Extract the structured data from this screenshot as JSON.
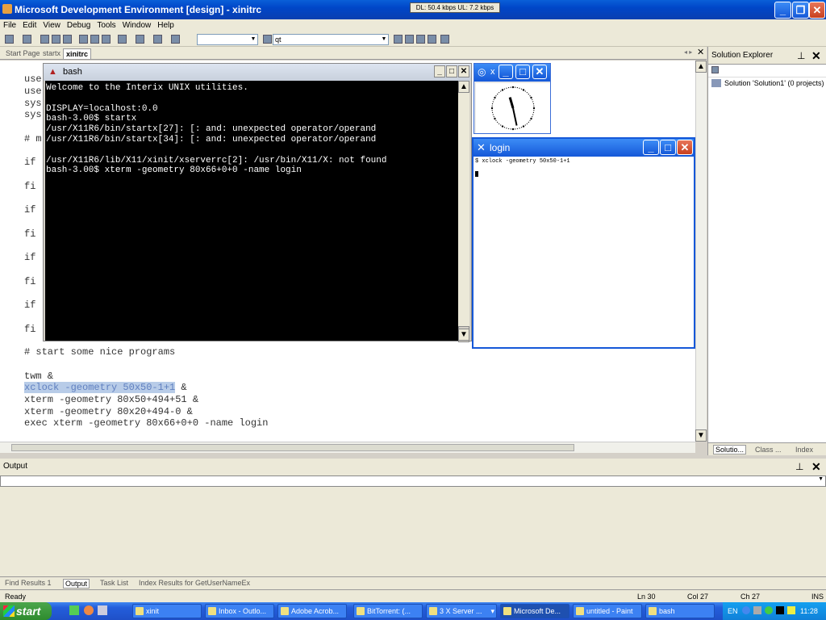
{
  "window": {
    "title": "Microsoft Development Environment [design] - xinitrc",
    "netmeter": "DL: 50.4 kbps  UL: 7.2 kbps"
  },
  "menu": [
    "File",
    "Edit",
    "View",
    "Debug",
    "Tools",
    "Window",
    "Help"
  ],
  "toolbar": {
    "combo1": "",
    "combo2": "qt"
  },
  "tabs": [
    "Start Page",
    "startx",
    "xinitrc"
  ],
  "editor": {
    "lines": [
      "use",
      "use",
      "sys",
      "sys",
      "# m",
      "if",
      "fi",
      "if",
      "fi",
      "if",
      "fi",
      "if",
      "fi",
      "# start some nice programs",
      "",
      "twm &",
      "xclock -geometry 50x50-1+1 &",
      "xterm -geometry 80x50+494+51 &",
      "xterm -geometry 80x20+494-0 &",
      "exec xterm -geometry 80x66+0+0 -name login"
    ],
    "selected": "xclock -geometry 50x50-1+1",
    "sel_rest": " &"
  },
  "bash": {
    "title": "bash",
    "content": "Welcome to the Interix UNIX utilities.\n\nDISPLAY=localhost:0.0\nbash-3.00$ startx\n/usr/X11R6/bin/startx[27]: [: and: unexpected operator/operand\n/usr/X11R6/bin/startx[34]: [: and: unexpected operator/operand\n\n/usr/X11R6/lib/X11/xinit/xserverrc[2]: /usr/bin/X11/X: not found\nbash-3.00$ xterm -geometry 80x66+0+0 -name login"
  },
  "xclock": {
    "title": "x",
    "time": {
      "hour": 11,
      "minute": 28
    }
  },
  "login": {
    "title": "login",
    "content": "$ xclock -geometry 50x50-1+1"
  },
  "solution_explorer": {
    "title": "Solution Explorer",
    "item": "Solution 'Solution1' (0 projects)",
    "tabs": [
      "Solutio...",
      "Class ...",
      "Index"
    ]
  },
  "output": {
    "title": "Output"
  },
  "bottom_tabs": [
    "Find Results 1",
    "Output",
    "Task List",
    "Index Results for GetUserNameEx"
  ],
  "status": {
    "ready": "Ready",
    "ln": "Ln 30",
    "col": "Col 27",
    "ch": "Ch 27",
    "ins": "INS"
  },
  "taskbar": {
    "start": "start",
    "tasks": [
      "xinit",
      "Inbox - Outlo...",
      "Adobe Acrob...",
      "BitTorrent: (...",
      "3 X Server ...",
      "Microsoft De...",
      "untitled - Paint",
      "bash"
    ],
    "lang": "EN",
    "time": "11:28"
  },
  "colors": {
    "xp_blue": "#245edb",
    "start_green": "#2e8b2e",
    "selection": "#b8cce8"
  }
}
